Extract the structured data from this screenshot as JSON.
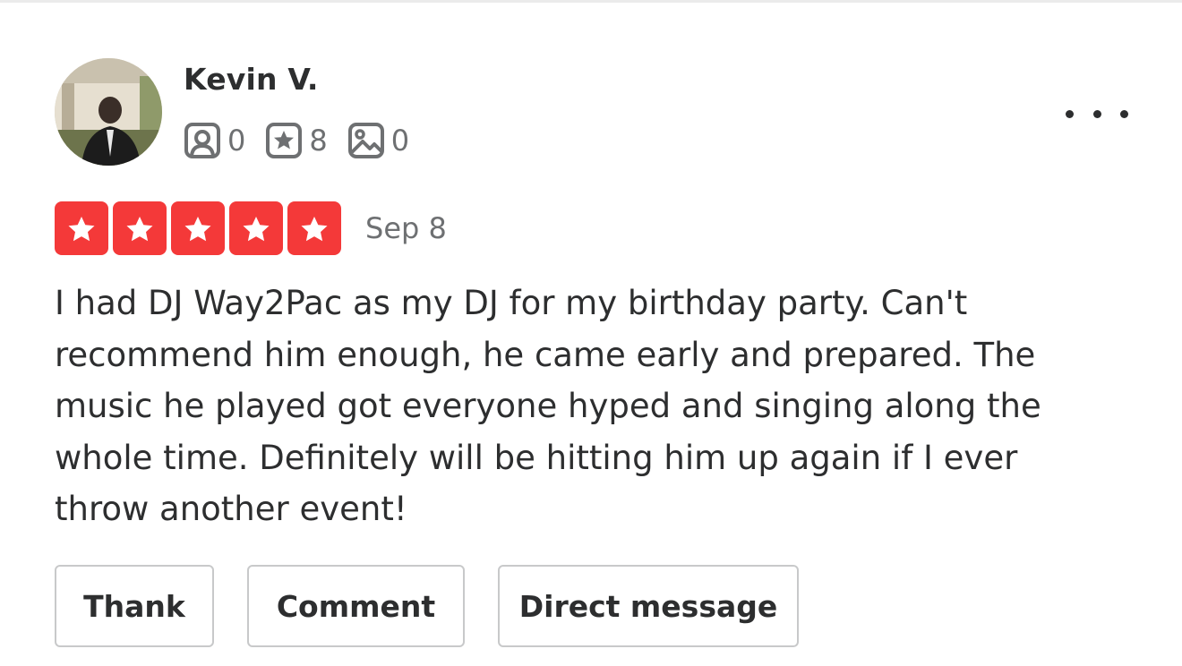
{
  "review": {
    "user": {
      "name": "Kevin V.",
      "stats": [
        {
          "icon": "friends-icon",
          "value": "0"
        },
        {
          "icon": "reviews-star-icon",
          "value": "8"
        },
        {
          "icon": "photos-icon",
          "value": "0"
        }
      ]
    },
    "rating": {
      "stars": 5,
      "max": 5,
      "color": "#f43939"
    },
    "date": "Sep 8",
    "text": "I had DJ Way2Pac as my DJ for my birthday party. Can't recommend him enough, he came early and prepared. The music he played got everyone hyped and singing along the whole time. Definitely will be hitting him up again if I ever throw another event!",
    "actions": {
      "thank_label": "Thank",
      "comment_label": "Comment",
      "dm_label": "Direct message"
    },
    "more_icon": "more-horizontal-icon"
  }
}
